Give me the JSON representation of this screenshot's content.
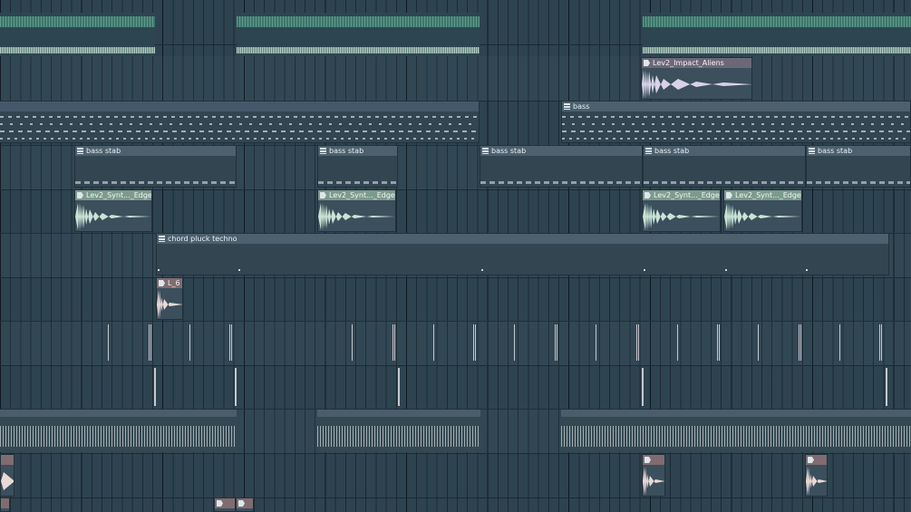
{
  "playlist": {
    "clips": {
      "impact": "Lev2_Impact_Aliens",
      "bass": "bass",
      "bass_stab_1": "bass stab",
      "bass_stab_2": "bass stab",
      "bass_stab_3": "bass stab",
      "bass_stab_4": "bass stab",
      "bass_stab_5": "bass stab",
      "synth_1": "Lev2_Synt..._Edge #2",
      "synth_2": "Lev2_Synt..._Edge #2",
      "synth_3": "Lev2_Synt..._Edge #2",
      "synth_4": "Lev2_Synt..._Edge #2",
      "chord": "chord pluck techno",
      "short_clip": "L_6"
    },
    "icons": {
      "audio": "audio-clip-icon",
      "pattern": "pattern-clip-icon"
    },
    "colors": {
      "background": "#2e4350",
      "audio_green": "#7c9a8d",
      "audio_purple": "#6c6878",
      "audio_rose": "#806c70",
      "pattern_header": "#4c606e",
      "teal_notes": "#63a493"
    }
  }
}
